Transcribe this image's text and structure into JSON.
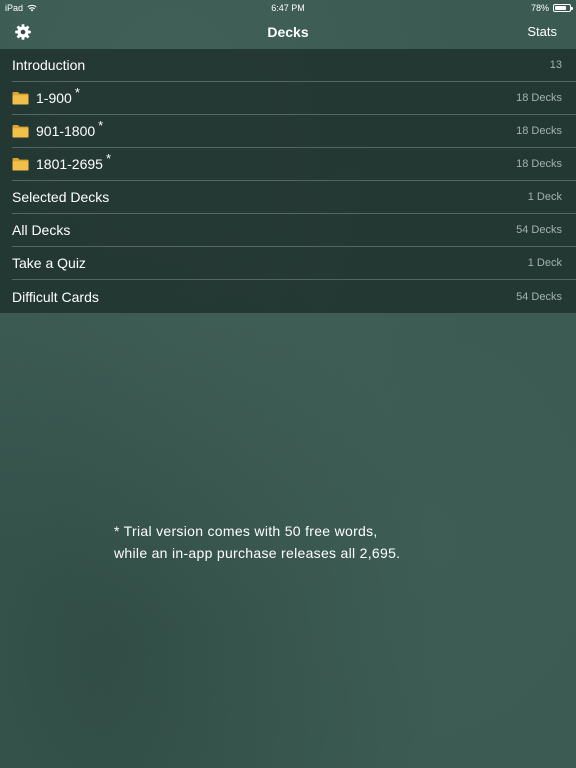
{
  "status_bar": {
    "device": "iPad",
    "time": "6:47 PM",
    "battery_percent": "78%",
    "battery_level": 0.78
  },
  "nav": {
    "title": "Decks",
    "stats_label": "Stats",
    "settings_icon": "gear-icon"
  },
  "decks": [
    {
      "label": "Introduction",
      "count": "13",
      "folder": false,
      "asterisk": ""
    },
    {
      "label": "1-900",
      "count": "18 Decks",
      "folder": true,
      "asterisk": "*"
    },
    {
      "label": "901-1800",
      "count": "18 Decks",
      "folder": true,
      "asterisk": "*"
    },
    {
      "label": "1801-2695",
      "count": "18 Decks",
      "folder": true,
      "asterisk": "*"
    },
    {
      "label": "Selected Decks",
      "count": "1 Deck",
      "folder": false,
      "asterisk": ""
    },
    {
      "label": "All Decks",
      "count": "54 Decks",
      "folder": false,
      "asterisk": ""
    },
    {
      "label": "Take a Quiz",
      "count": "1 Deck",
      "folder": false,
      "asterisk": ""
    },
    {
      "label": "Difficult Cards",
      "count": "54 Decks",
      "folder": false,
      "asterisk": ""
    }
  ],
  "footnote": {
    "line1": "* Trial version comes with 50 free words,",
    "line2": "while an in-app purchase releases all 2,695."
  },
  "colors": {
    "background": "#3a5a52",
    "list_background": "#1e2e2a",
    "count_text": "#a4b2ac",
    "folder": "#f2c04a"
  }
}
